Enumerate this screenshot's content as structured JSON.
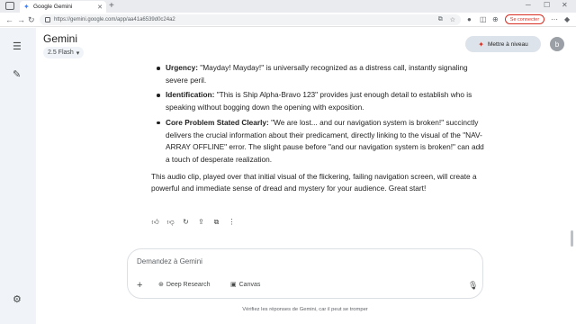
{
  "browser": {
    "tab_title": "Google Gemini",
    "url": "https://gemini.google.com/app/aa41a6539d0c24a2",
    "signin_label": "Se connecter"
  },
  "header": {
    "app_title": "Gemini",
    "model_label": "2.5 Flash",
    "upgrade_label": "Mettre à niveau",
    "avatar_letter": "b"
  },
  "response": {
    "bullets": [
      {
        "term": "Urgency:",
        "text": " \"Mayday! Mayday!\" is universally recognized as a distress call, instantly signaling severe peril."
      },
      {
        "term": "Identification:",
        "text": " \"This is Ship Alpha-Bravo 123\" provides just enough detail to establish who is speaking without bogging down the opening with exposition."
      },
      {
        "term": "Core Problem Stated Clearly:",
        "text": " \"We are lost... and our navigation system is broken!\" succinctly delivers the crucial information about their predicament, directly linking to the visual of the \"NAV-ARRAY OFFLINE\" error. The slight pause before \"and our navigation system is broken!\" can add a touch of desperate realization."
      }
    ],
    "paragraph": "This audio clip, played over that initial visual of the flickering, failing navigation screen, will create a powerful and immediate sense of dread and mystery for your audience. Great start!"
  },
  "composer": {
    "placeholder": "Demandez à Gemini",
    "deep_research_label": "Deep Research",
    "canvas_label": "Canvas"
  },
  "disclaimer": "Vérifiez les réponses de Gemini, car il peut se tromper",
  "colors": {
    "sidebar_bg": "#f0f4f9",
    "upgrade_bg": "#dde3ea",
    "signin_accent": "#d93025"
  }
}
